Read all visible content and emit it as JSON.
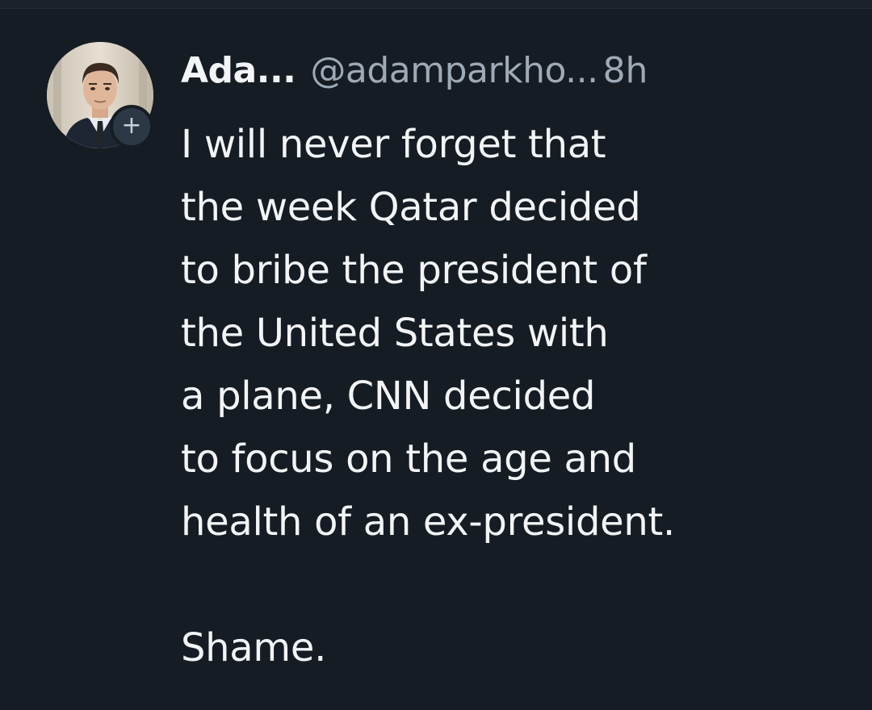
{
  "post": {
    "display_name": "Ada...",
    "handle": "@adamparkho...",
    "timestamp": "8h",
    "follow_symbol": "+",
    "body_lines": [
      "I will never forget that",
      "the week Qatar decided",
      "to bribe the president of",
      "the United States with",
      "a plane, CNN decided",
      "to focus on the age and",
      "health of an ex-president."
    ],
    "closing_line": "Shame."
  },
  "colors": {
    "background": "#161c23",
    "text_primary": "#f2f4f6",
    "text_secondary": "#9eaab6",
    "badge_background": "#2c3845"
  },
  "icons": {
    "avatar": "profile-photo",
    "follow": "plus-icon"
  }
}
